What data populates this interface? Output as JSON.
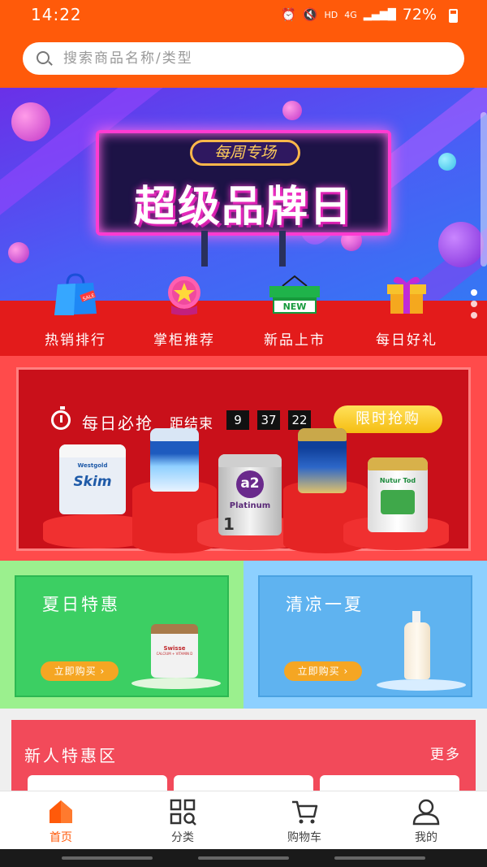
{
  "status_bar": {
    "time": "14:22",
    "network": "HD",
    "signal": "4G",
    "battery": "72%"
  },
  "search": {
    "placeholder": "搜索商品名称/类型"
  },
  "banner": {
    "sign_small": "每周专场",
    "sign_title": "超级品牌日",
    "categories": [
      {
        "label": "热销排行",
        "icon": "shopping-bag-icon"
      },
      {
        "label": "掌柜推荐",
        "icon": "star-badge-icon"
      },
      {
        "label": "新品上市",
        "icon": "new-gift-icon"
      },
      {
        "label": "每日好礼",
        "icon": "gift-box-icon"
      }
    ],
    "new_tag": "NEW",
    "sale_tag": "SALE"
  },
  "daily_deal": {
    "title": "每日必抢",
    "ends_label": "距结束",
    "countdown": {
      "hours": "9",
      "minutes": "37",
      "seconds": "22"
    },
    "button": "限时抢购",
    "products": [
      {
        "brand": "Skim",
        "maker": "Westgold"
      },
      {
        "brand": "",
        "maker": ""
      },
      {
        "brand": "a2",
        "sub": "Platinum",
        "stage": "1"
      },
      {
        "brand": "",
        "maker": ""
      },
      {
        "brand": "Nutur Tod",
        "maker": ""
      }
    ]
  },
  "promos": [
    {
      "title": "夏日特惠",
      "button": "立即购买",
      "product": "Swisse",
      "product_sub": "CALCIUM + VITAMIN D"
    },
    {
      "title": "清凉一夏",
      "button": "立即购买",
      "product": "",
      "product_sub": ""
    }
  ],
  "new_user": {
    "title": "新人特惠区",
    "more": "更多"
  },
  "tabbar": [
    {
      "label": "首页",
      "icon": "home-icon",
      "active": true
    },
    {
      "label": "分类",
      "icon": "category-grid-icon",
      "active": false
    },
    {
      "label": "购物车",
      "icon": "cart-icon",
      "active": false
    },
    {
      "label": "我的",
      "icon": "profile-icon",
      "active": false
    }
  ],
  "colors": {
    "brand": "#ff5a0a",
    "deal_red": "#c9101a",
    "green_tile": "#3ccf63",
    "blue_tile": "#5fb3f0",
    "new_zone": "#f24a5a",
    "gold_button": "#f5bd12"
  }
}
